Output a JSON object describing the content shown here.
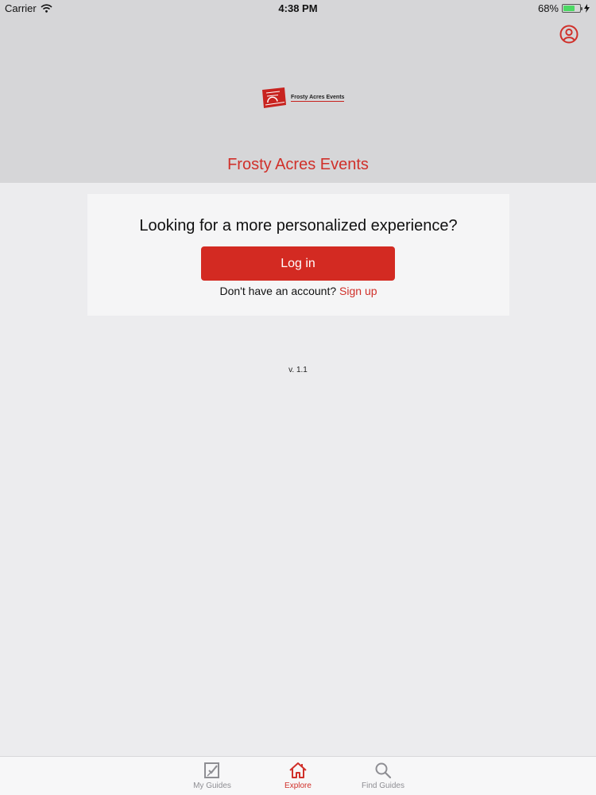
{
  "status_bar": {
    "carrier": "Carrier",
    "time": "4:38 PM",
    "battery": "68%",
    "battery_level": 0.68
  },
  "header": {
    "title": "Frosty Acres Events",
    "logo_text": "Frosty Acres Events",
    "profile_icon": "user-circle-icon"
  },
  "card": {
    "heading": "Looking for a more personalized experience?",
    "login_label": "Log in",
    "signup_prompt": "Don't have an account?",
    "signup_link": "Sign up"
  },
  "version": "v. 1.1",
  "tabs": [
    {
      "label": "My Guides",
      "icon": "checklist-icon",
      "active": false
    },
    {
      "label": "Explore",
      "icon": "home-icon",
      "active": true
    },
    {
      "label": "Find Guides",
      "icon": "search-icon",
      "active": false
    }
  ],
  "colors": {
    "accent": "#d32a22",
    "header_bg": "#d6d6d8",
    "page_bg": "#ececee"
  }
}
